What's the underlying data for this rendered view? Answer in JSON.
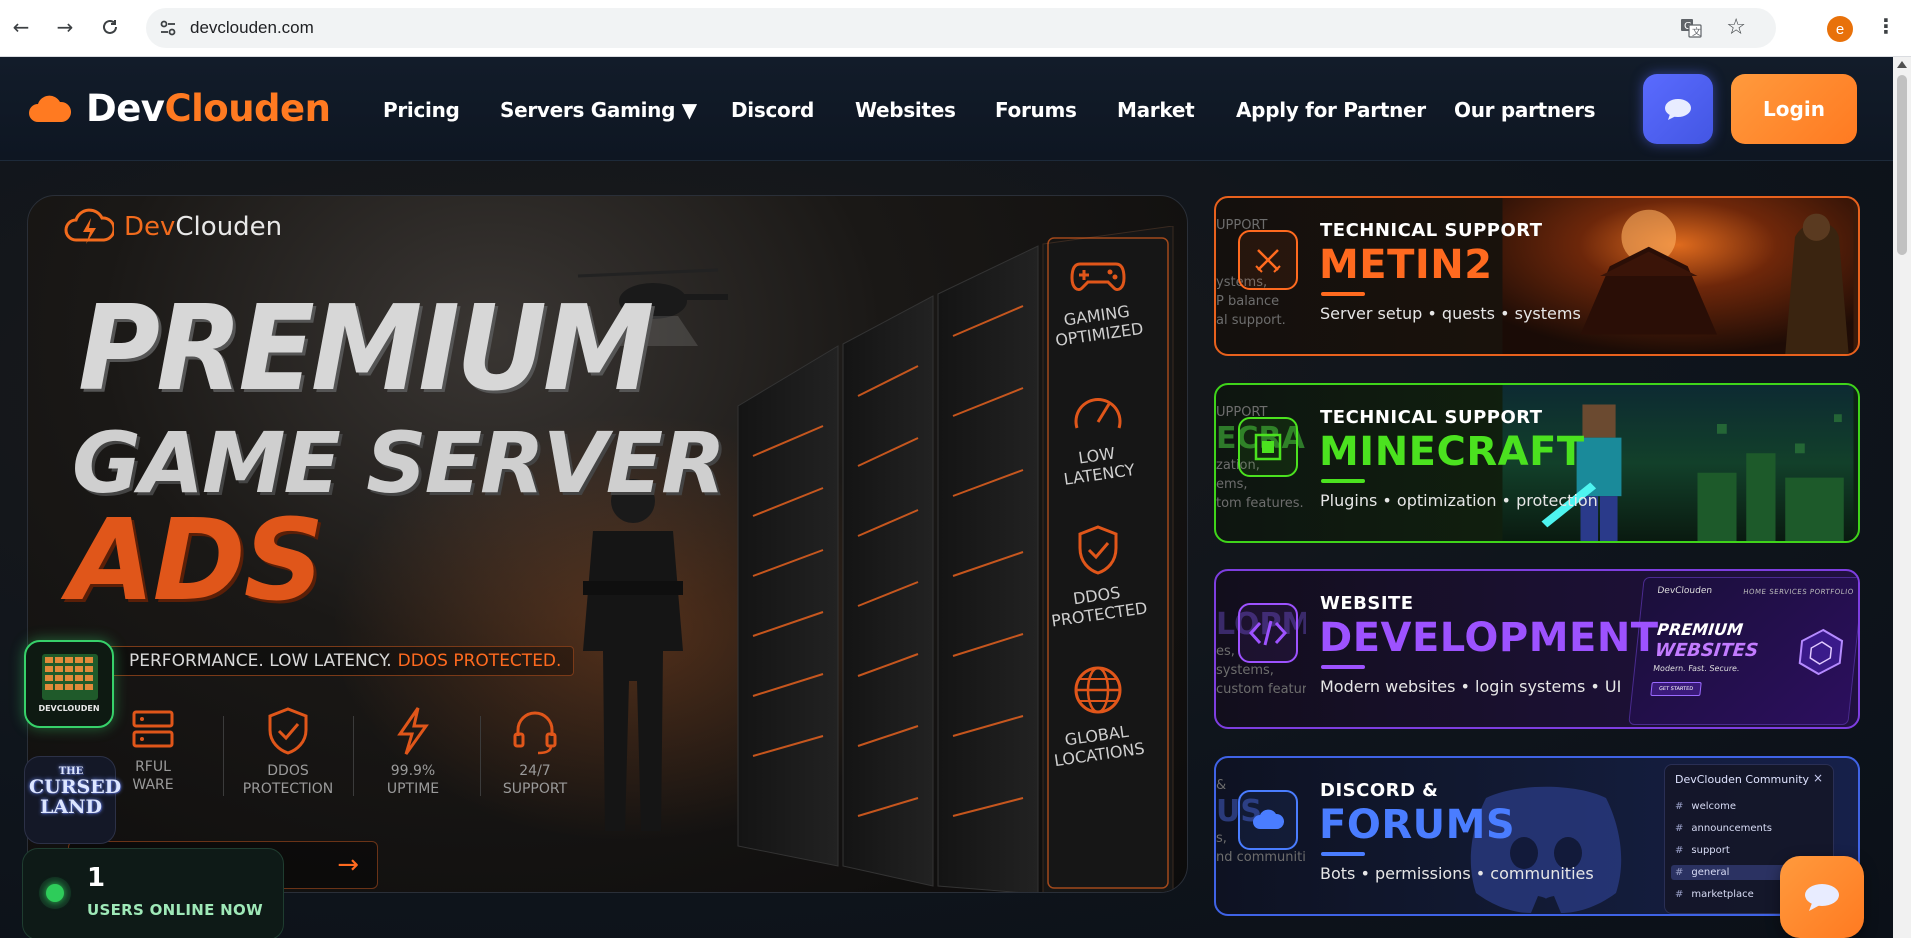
{
  "browser": {
    "url": "devclouden.com",
    "profile_initial": "e"
  },
  "header": {
    "brand_dev": "Dev",
    "brand_clouden": "Clouden",
    "nav": [
      {
        "label": "Pricing"
      },
      {
        "label": "Servers Gaming ▼"
      },
      {
        "label": "Discord"
      },
      {
        "label": "Websites"
      },
      {
        "label": "Forums"
      },
      {
        "label": "Market"
      },
      {
        "label": "Apply for Partner"
      },
      {
        "label": "Our partners"
      }
    ],
    "login_label": "Login"
  },
  "hero": {
    "logo_dev": "Dev",
    "logo_clouden": "Clouden",
    "line1": "PREMIUM",
    "line2": "GAME SERVER",
    "line3": "ADS",
    "tagline_main": "PERFORMANCE. LOW LATENCY.",
    "tagline_accent": "DDOS PROTECTED.",
    "features": [
      {
        "line1": "RFUL",
        "line2": "WARE"
      },
      {
        "line1": "DDOS",
        "line2": "PROTECTION"
      },
      {
        "line1": "99.9%",
        "line2": "UPTIME"
      },
      {
        "line1": "24/7",
        "line2": "SUPPORT"
      }
    ],
    "side_badges": [
      {
        "line1": "GAMING",
        "line2": "OPTIMIZED"
      },
      {
        "line1": "LOW",
        "line2": "LATENCY"
      },
      {
        "line1": "DDOS",
        "line2": "PROTECTED"
      },
      {
        "line1": "GLOBAL",
        "line2": "LOCATIONS"
      }
    ]
  },
  "cards": [
    {
      "label": "TECHNICAL SUPPORT",
      "title": "METIN2",
      "subtitle": "Server setup • quests • systems",
      "ghost": [
        "UPPORT",
        "",
        "ystems,",
        "P balance",
        "al support."
      ],
      "color": "#ff6a1f"
    },
    {
      "label": "TECHNICAL SUPPORT",
      "title": "MINECRAFT",
      "subtitle": "Plugins • optimization • protection",
      "ghost": [
        "UPPORT",
        "ECRAFT",
        "",
        "zation,",
        "ems,",
        "tom features."
      ],
      "color": "#4be21f"
    },
    {
      "label": "WEBSITE",
      "title": "DEVELOPMENT",
      "subtitle": "Modern websites • login systems • UI",
      "ghost": [
        "",
        "LOPMENT",
        "",
        "es,",
        "systems,",
        " custom features."
      ],
      "color": "#9d52ff"
    },
    {
      "label": "DISCORD &",
      "title": "FORUMS",
      "subtitle": "Bots • permissions • communities",
      "ghost": [
        "",
        "&",
        "US",
        "",
        "s,",
        "nd communities."
      ],
      "color": "#4a7dff"
    }
  ],
  "website_mock": {
    "logo": "DevClouden",
    "nav": "HOME   SERVICES   PORTFOLIO",
    "title1": "PREMIUM",
    "title2": "WEBSITES",
    "tagline": "Modern. Fast. Secure.",
    "button": "GET STARTED"
  },
  "discord_panel": {
    "title": "DevClouden Community",
    "channels": [
      "welcome",
      "announcements",
      "support",
      "general",
      "marketplace"
    ],
    "active_channel": "general"
  },
  "widgets": {
    "devclouden_label": "DEVCLOUDEN",
    "cursed_line1": "THE",
    "cursed_line2": "CURSED",
    "cursed_line3": "LAND",
    "online_count": "1",
    "online_label": "USERS ONLINE NOW"
  },
  "colors": {
    "accent_orange": "#ff7a21",
    "chat_blue": "#5a6bff",
    "online_green": "#2ecc5a"
  }
}
